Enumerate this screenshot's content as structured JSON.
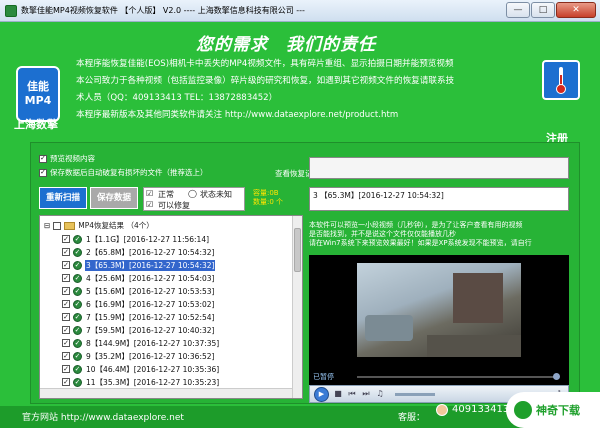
{
  "window": {
    "title": "数擎佳能MP4视频恢复软件  【个人版】  V2.0 ---- 上海数擎信息科技有限公司 ---"
  },
  "header": {
    "slogan": "您的需求　我们的责任",
    "logo_text": [
      "佳能",
      "MP4"
    ],
    "company": "上海数擎",
    "register": "注册",
    "description": [
      "本程序能恢复佳能(EOS)相机卡中丢失的MP4视频文件，具有碎片重组、显示拍摄日期并能预览视频",
      "本公司致力于各种视频（包括监控录像）碎片级的研究和恢复，如遇到其它视频文件的恢复请联系技",
      "术人员（QQ：409133413  TEL：13872883452）",
      "本程序最新版本及其他同类软件请关注 http://www.dataexplore.net/product.htm"
    ]
  },
  "options": {
    "preview": "预览视频内容",
    "autosave": "保存数据后自动破复有损坏的文件（推荐选上）",
    "list_link": "查看恢复记录"
  },
  "buttons": {
    "scan": "重新扫描",
    "save": "保存数据"
  },
  "legend": {
    "normal": "正常",
    "unknown": "状态未知",
    "repairable": "可以修复"
  },
  "counts": {
    "capacity": "容量:0B",
    "quantity": "数量:0 个"
  },
  "tree": {
    "root": "MP4恢复结果 （4个）",
    "items": [
      {
        "text": "1【1.1G】[2016-12-27 11:56:14]"
      },
      {
        "text": "2【65.8M】[2016-12-27 10:54:32]"
      },
      {
        "text": "3【65.3M】[2016-12-27 10:54:32]"
      },
      {
        "text": "4【25.6M】[2016-12-27 10:54:03]"
      },
      {
        "text": "5【15.6M】[2016-12-27 10:53:53]"
      },
      {
        "text": "6【16.9M】[2016-12-27 10:53:02]"
      },
      {
        "text": "7【15.9M】[2016-12-27 10:52:54]"
      },
      {
        "text": "7【59.5M】[2016-12-27 10:40:32]"
      },
      {
        "text": "8【144.9M】[2016-12-27 10:37:35]"
      },
      {
        "text": "9【35.2M】[2016-12-27 10:36:52]"
      },
      {
        "text": "10【46.4M】[2016-12-27 10:35:36]"
      },
      {
        "text": "11【35.3M】[2016-12-27 10:35:23]"
      }
    ],
    "selected_index": 2
  },
  "info": {
    "selected": "3 【65.3M】[2016-12-27 10:54:32]"
  },
  "note": [
    "本软件可以预览一小段视频（几秒钟），是为了让客户查看有用的视频",
    "是否能找到，并不是说这个文件仅仅能播放几秒",
    "请在Win7系统下来预览效果最好！如果是XP系统发现不能预览，请自行"
  ],
  "player": {
    "status": "已暂停"
  },
  "footer": {
    "website": "官方网站 http://www.dataexplore.net",
    "cs_label": "客服：",
    "qq": "409133413"
  },
  "watermark": {
    "text": "神奇下载"
  }
}
